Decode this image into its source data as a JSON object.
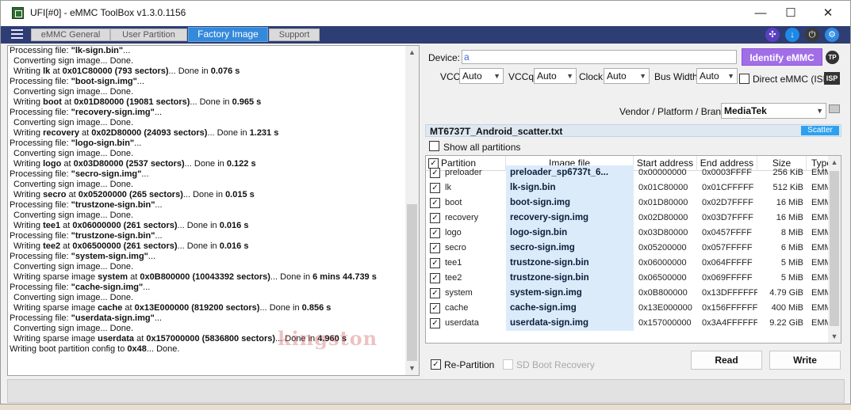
{
  "window": {
    "title": "UFI[#0] - eMMC ToolBox v1.3.0.1156",
    "controls": {
      "minimize": "—",
      "maximize": "☐",
      "close": "✕"
    }
  },
  "tabs": [
    {
      "label": "eMMC General",
      "active": false
    },
    {
      "label": "User Partition",
      "active": false
    },
    {
      "label": "Factory Image",
      "active": true
    },
    {
      "label": "Support",
      "active": false
    }
  ],
  "log": [
    {
      "type": "main",
      "pre": "Processing file: ",
      "b": "\"lk-sign.bin\"",
      "post": "..."
    },
    {
      "type": "sub",
      "text": "Converting sign image... Done."
    },
    {
      "type": "sub",
      "pre": "Writing ",
      "b1": "lk",
      "mid1": " at ",
      "b2": "0x01C80000 (793 sectors)",
      "mid2": "... Done in ",
      "b3": "0.076 s"
    },
    {
      "type": "main",
      "pre": "Processing file: ",
      "b": "\"boot-sign.img\"",
      "post": "..."
    },
    {
      "type": "sub",
      "text": "Converting sign image... Done."
    },
    {
      "type": "sub",
      "pre": "Writing ",
      "b1": "boot",
      "mid1": " at ",
      "b2": "0x01D80000 (19081 sectors)",
      "mid2": "... Done in ",
      "b3": "0.965 s"
    },
    {
      "type": "main",
      "pre": "Processing file: ",
      "b": "\"recovery-sign.img\"",
      "post": "..."
    },
    {
      "type": "sub",
      "text": "Converting sign image... Done."
    },
    {
      "type": "sub",
      "pre": "Writing ",
      "b1": "recovery",
      "mid1": " at ",
      "b2": "0x02D80000 (24093 sectors)",
      "mid2": "... Done in ",
      "b3": "1.231 s"
    },
    {
      "type": "main",
      "pre": "Processing file: ",
      "b": "\"logo-sign.bin\"",
      "post": "..."
    },
    {
      "type": "sub",
      "text": "Converting sign image... Done."
    },
    {
      "type": "sub",
      "pre": "Writing ",
      "b1": "logo",
      "mid1": " at ",
      "b2": "0x03D80000 (2537 sectors)",
      "mid2": "... Done in ",
      "b3": "0.122 s"
    },
    {
      "type": "main",
      "pre": "Processing file: ",
      "b": "\"secro-sign.img\"",
      "post": "..."
    },
    {
      "type": "sub",
      "text": "Converting sign image... Done."
    },
    {
      "type": "sub",
      "pre": "Writing ",
      "b1": "secro",
      "mid1": " at ",
      "b2": "0x05200000 (265 sectors)",
      "mid2": "... Done in ",
      "b3": "0.015 s"
    },
    {
      "type": "main",
      "pre": "Processing file: ",
      "b": "\"trustzone-sign.bin\"",
      "post": "..."
    },
    {
      "type": "sub",
      "text": "Converting sign image... Done."
    },
    {
      "type": "sub",
      "pre": "Writing ",
      "b1": "tee1",
      "mid1": " at ",
      "b2": "0x06000000 (261 sectors)",
      "mid2": "... Done in ",
      "b3": "0.016 s"
    },
    {
      "type": "main",
      "pre": "Processing file: ",
      "b": "\"trustzone-sign.bin\"",
      "post": "..."
    },
    {
      "type": "sub",
      "pre": "Writing ",
      "b1": "tee2",
      "mid1": " at ",
      "b2": "0x06500000 (261 sectors)",
      "mid2": "... Done in ",
      "b3": "0.016 s"
    },
    {
      "type": "main",
      "pre": "Processing file: ",
      "b": "\"system-sign.img\"",
      "post": "..."
    },
    {
      "type": "sub",
      "text": "Converting sign image... Done."
    },
    {
      "type": "sub",
      "pre": "Writing sparse image ",
      "b1": "system",
      "mid1": " at ",
      "b2": "0x0B800000 (10043392 sectors)",
      "mid2": "... Done in ",
      "b3": "6 mins 44.739 s"
    },
    {
      "type": "main",
      "pre": "Processing file: ",
      "b": "\"cache-sign.img\"",
      "post": "..."
    },
    {
      "type": "sub",
      "text": "Converting sign image... Done."
    },
    {
      "type": "sub",
      "pre": "Writing sparse image ",
      "b1": "cache",
      "mid1": " at ",
      "b2": "0x13E000000 (819200 sectors)",
      "mid2": "... Done in ",
      "b3": "0.856 s"
    },
    {
      "type": "main",
      "pre": "Processing file: ",
      "b": "\"userdata-sign.img\"",
      "post": "..."
    },
    {
      "type": "sub",
      "text": "Converting sign image... Done."
    },
    {
      "type": "sub",
      "pre": "Writing sparse image ",
      "b1": "userdata",
      "mid1": " at ",
      "b2": "0x157000000 (5836800 sectors)",
      "mid2": "... Done in ",
      "b3": "4.960 s"
    },
    {
      "type": "main",
      "pre": "Writing boot partition config to ",
      "b": "0x48",
      "post": "... Done."
    }
  ],
  "watermark": "kingston",
  "device": {
    "label": "Device:",
    "value": "a",
    "identify_label": "Identify eMMC",
    "tp_label": "TP",
    "vcc_label": "VCC:",
    "vcc_value": "Auto",
    "vccq_label": "VCCq:",
    "vccq_value": "Auto",
    "clock_label": "Clock:",
    "clock_value": "Auto",
    "buswidth_label": "Bus Width:",
    "buswidth_value": "Auto",
    "direct_label": "Direct eMMC (ISP)",
    "isp_label": "ISP",
    "vendor_label": "Vendor / Platform / Brand:",
    "vendor_value": "MediaTek"
  },
  "scatter": {
    "filename": "MT6737T_Android_scatter.txt",
    "badge": "Scatter",
    "show_all_label": "Show all partitions"
  },
  "table": {
    "headers": [
      "Partition",
      "Image file",
      "Start address",
      "End address",
      "Size",
      "Type"
    ],
    "rows": [
      {
        "partition": "preloader",
        "image": "preloader_sp6737t_6...",
        "start": "0x00000000",
        "end": "0x0003FFFF",
        "size": "256 KiB",
        "type": "EMM"
      },
      {
        "partition": "lk",
        "image": "lk-sign.bin",
        "start": "0x01C80000",
        "end": "0x01CFFFFF",
        "size": "512 KiB",
        "type": "EMM"
      },
      {
        "partition": "boot",
        "image": "boot-sign.img",
        "start": "0x01D80000",
        "end": "0x02D7FFFF",
        "size": "16 MiB",
        "type": "EMM"
      },
      {
        "partition": "recovery",
        "image": "recovery-sign.img",
        "start": "0x02D80000",
        "end": "0x03D7FFFF",
        "size": "16 MiB",
        "type": "EMM"
      },
      {
        "partition": "logo",
        "image": "logo-sign.bin",
        "start": "0x03D80000",
        "end": "0x0457FFFF",
        "size": "8 MiB",
        "type": "EMM"
      },
      {
        "partition": "secro",
        "image": "secro-sign.img",
        "start": "0x05200000",
        "end": "0x057FFFFF",
        "size": "6 MiB",
        "type": "EMM"
      },
      {
        "partition": "tee1",
        "image": "trustzone-sign.bin",
        "start": "0x06000000",
        "end": "0x064FFFFF",
        "size": "5 MiB",
        "type": "EMM"
      },
      {
        "partition": "tee2",
        "image": "trustzone-sign.bin",
        "start": "0x06500000",
        "end": "0x069FFFFF",
        "size": "5 MiB",
        "type": "EMM"
      },
      {
        "partition": "system",
        "image": "system-sign.img",
        "start": "0x0B800000",
        "end": "0x13DFFFFFF",
        "size": "4.79 GiB",
        "type": "EMM"
      },
      {
        "partition": "cache",
        "image": "cache-sign.img",
        "start": "0x13E000000",
        "end": "0x156FFFFFF",
        "size": "400 MiB",
        "type": "EMM"
      },
      {
        "partition": "userdata",
        "image": "userdata-sign.img",
        "start": "0x157000000",
        "end": "0x3A4FFFFFF",
        "size": "9.22 GiB",
        "type": "EMM"
      }
    ]
  },
  "footer": {
    "repartition_label": "Re-Partition",
    "sdboot_label": "SD Boot Recovery",
    "read_label": "Read",
    "write_label": "Write"
  },
  "colors": {
    "tabbar": "#2e3d73",
    "active_tab": "#3489da",
    "identify_button": "#a26ee8",
    "image_cell": "#dcebfa",
    "scatter_badge": "#2ea0f0"
  }
}
